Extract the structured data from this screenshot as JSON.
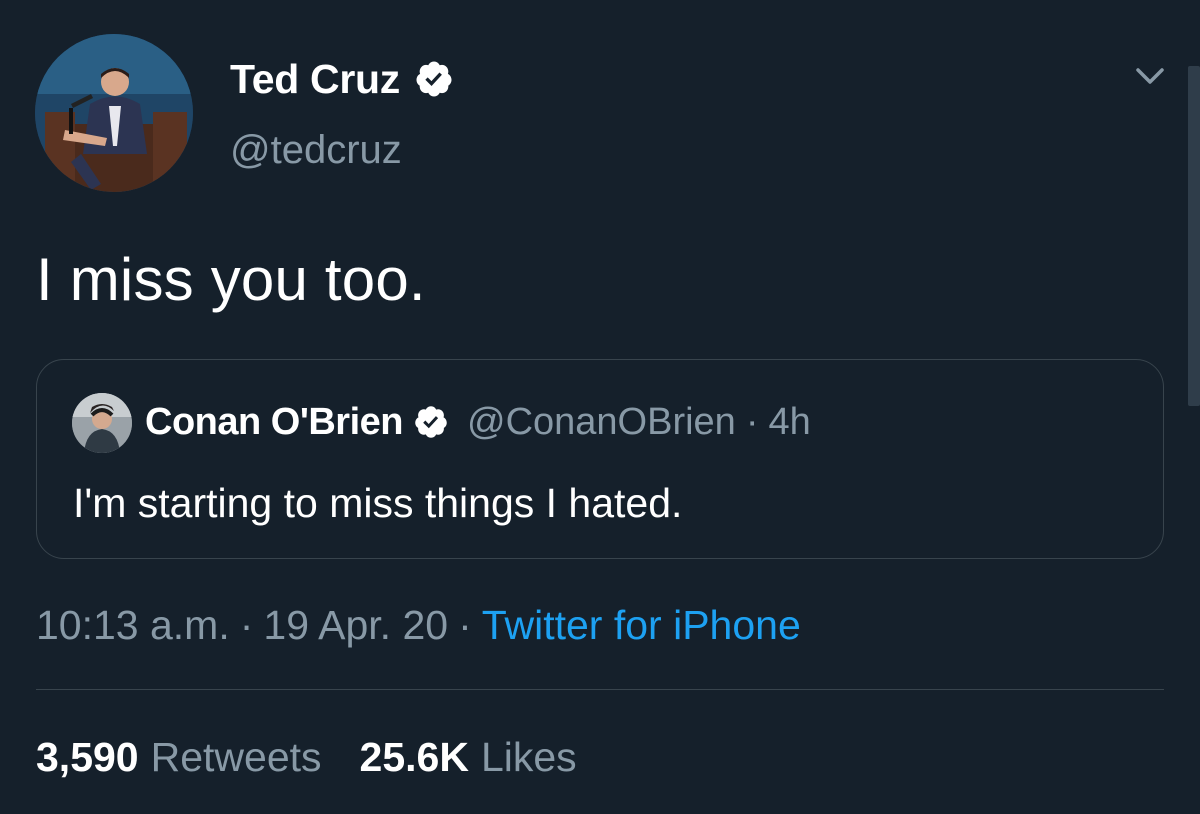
{
  "tweet": {
    "author": {
      "display_name": "Ted Cruz",
      "handle": "@tedcruz",
      "verified": true,
      "avatar_icon": "profile-photo"
    },
    "text": "I miss you too.",
    "menu_icon": "chevron-down-icon",
    "quoted_tweet": {
      "display_name": "Conan O'Brien",
      "handle": "@ConanOBrien",
      "separator": "·",
      "time": "4h",
      "verified": true,
      "text": "I'm starting to miss things I hated."
    },
    "meta": {
      "time": "10:13 a.m.",
      "separator": "·",
      "date": "19 Apr. 20",
      "source": "Twitter for iPhone"
    },
    "stats": {
      "retweets_count": "3,590",
      "retweets_label": "Retweets",
      "likes_count": "25.6K",
      "likes_label": "Likes"
    }
  },
  "colors": {
    "background": "#15202b",
    "text_primary": "#ffffff",
    "text_secondary": "#8899a6",
    "link": "#1da1f2",
    "border": "#38444d"
  }
}
